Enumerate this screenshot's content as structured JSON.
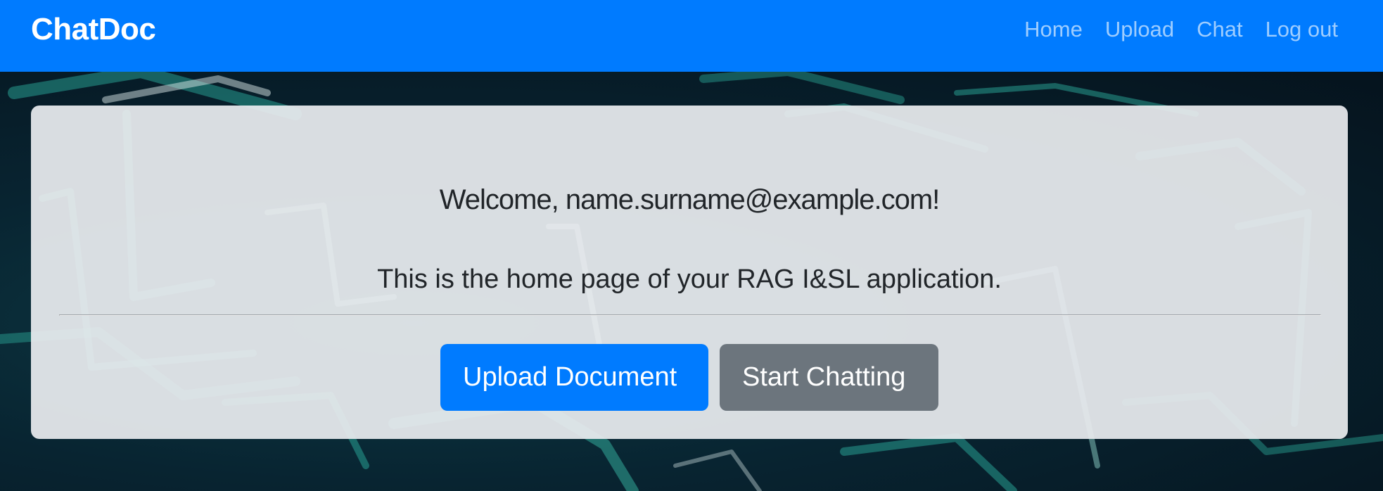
{
  "colors": {
    "navbar": "#007bff",
    "primary_button": "#007bff",
    "secondary_button": "#6c757d",
    "card_background": "#e9ecef",
    "text": "#212529"
  },
  "navbar": {
    "brand": "ChatDoc",
    "links": [
      {
        "label": "Home"
      },
      {
        "label": "Upload"
      },
      {
        "label": "Chat"
      },
      {
        "label": "Log out"
      }
    ]
  },
  "hero": {
    "title": "Welcome, name.surname@example.com!",
    "lead": "This is the home page of your RAG I&SL application.",
    "upload_button": "Upload Document",
    "chat_button": "Start Chatting"
  }
}
